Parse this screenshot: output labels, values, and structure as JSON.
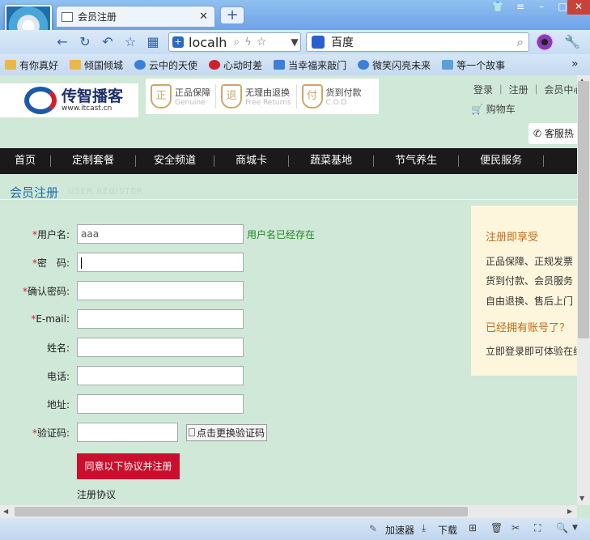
{
  "browser": {
    "tab_title": "会员注册",
    "new_tab": "+",
    "url": "localh",
    "search_engine": "百度"
  },
  "bookmarks": [
    "有你真好",
    "倾国倾城",
    "云中的天使",
    "心动时差",
    "当幸福来敲门",
    "微笑闪亮未来",
    "等一个故事"
  ],
  "bookmarks_more": "»",
  "header": {
    "logo_name": "传智播客",
    "logo_url": "www.itcast.cn",
    "badges": [
      {
        "title": "正品保障",
        "sub": "Genuine",
        "glyph": "正"
      },
      {
        "title": "无理由退换",
        "sub": "Free Returns",
        "glyph": "退"
      },
      {
        "title": "货到付款",
        "sub": "C.O.D",
        "glyph": "付"
      }
    ],
    "links": [
      "登录",
      "注册",
      "会员中心"
    ],
    "cart": "购物车",
    "service": "客服热"
  },
  "nav": [
    "首页",
    "定制套餐",
    "安全频道",
    "商城卡",
    "蔬菜基地",
    "节气养生",
    "便民服务"
  ],
  "register": {
    "title": "会员注册",
    "subtitle": "USER REGISTER",
    "fields": [
      {
        "label": "用户名:",
        "required": true,
        "value": "aaa"
      },
      {
        "label": "密　码:",
        "required": true,
        "value": ""
      },
      {
        "label": "确认密码:",
        "required": true,
        "value": ""
      },
      {
        "label": "E-mail:",
        "required": true,
        "value": ""
      },
      {
        "label": "姓名:",
        "required": false,
        "value": ""
      },
      {
        "label": "电话:",
        "required": false,
        "value": ""
      },
      {
        "label": "地址:",
        "required": false,
        "value": ""
      }
    ],
    "username_msg": "用户名已经存在",
    "captcha_label": "验证码:",
    "captcha_img": "点击更换验证码",
    "submit": "同意以下协议并注册",
    "agreement": "注册协议",
    "required_mark": "*"
  },
  "benefits": {
    "heading": "注册即享受",
    "items": [
      "正品保障、正规发票",
      "货到付款、会员服务",
      "自由退换、售后上门"
    ],
    "heading2": "已经拥有账号了？",
    "login_tip": "立即登录即可体验在线"
  },
  "status": {
    "accelerator": "加速器",
    "download": "下载"
  }
}
